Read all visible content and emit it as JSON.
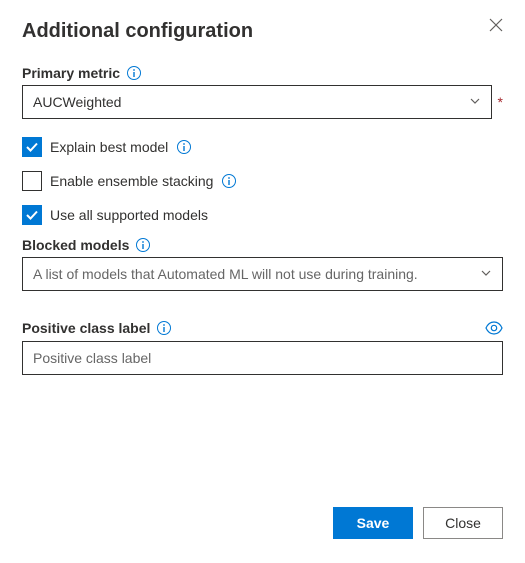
{
  "panel": {
    "title": "Additional configuration"
  },
  "primaryMetric": {
    "label": "Primary metric",
    "value": "AUCWeighted",
    "required": true
  },
  "checkboxes": {
    "explainBestModel": {
      "label": "Explain best model",
      "checked": true,
      "hasInfo": true
    },
    "ensembleStacking": {
      "label": "Enable ensemble stacking",
      "checked": false,
      "hasInfo": true
    },
    "useAllModels": {
      "label": "Use all supported models",
      "checked": true,
      "hasInfo": false
    }
  },
  "blockedModels": {
    "label": "Blocked models",
    "placeholder": "A list of models that Automated ML will not use during training."
  },
  "positiveClass": {
    "label": "Positive class label",
    "placeholder": "Positive class label",
    "value": ""
  },
  "footer": {
    "save": "Save",
    "close": "Close"
  }
}
